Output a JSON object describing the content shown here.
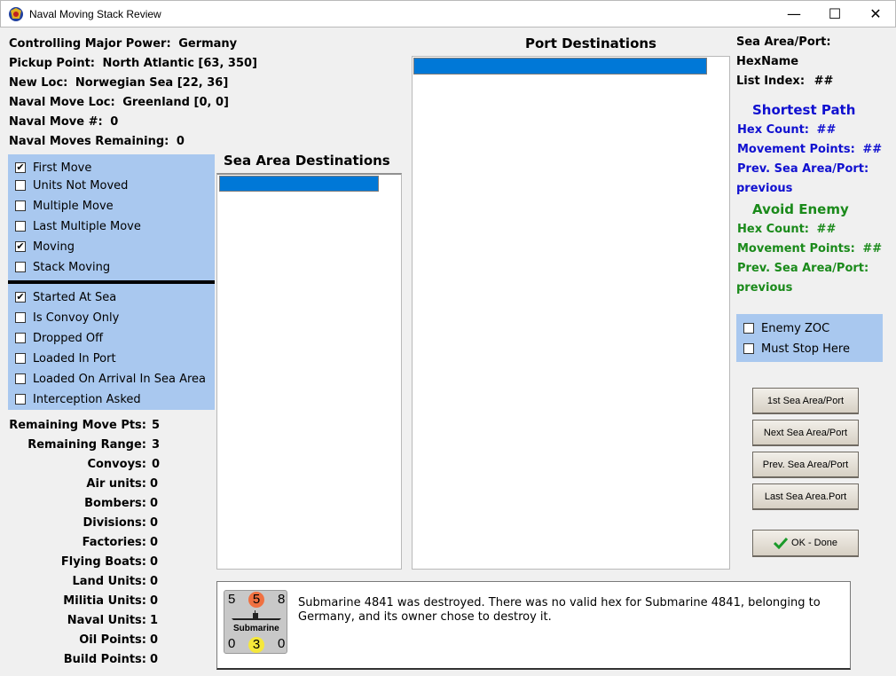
{
  "window": {
    "title": "Naval Moving Stack Review",
    "minimize": "—",
    "maximize": "☐",
    "close": "✕"
  },
  "info": {
    "controlling_label": "Controlling Major Power:",
    "controlling_value": "Germany",
    "pickup_label": "Pickup Point:",
    "pickup_value": "North Atlantic [63, 350]",
    "newloc_label": "New Loc:",
    "newloc_value": "Norwegian Sea [22, 36]",
    "navalmoveloc_label": "Naval Move Loc:",
    "navalmoveloc_value": "Greenland [0, 0]",
    "navalmove_label": "Naval Move #:",
    "navalmove_value": "0",
    "remaining_label": "Naval Moves Remaining:",
    "remaining_value": "0"
  },
  "flags1": [
    {
      "label": "First Move",
      "checked": true
    },
    {
      "label": "Units Not Moved",
      "checked": false
    },
    {
      "label": "Multiple Move",
      "checked": false
    },
    {
      "label": "Last Multiple Move",
      "checked": false
    },
    {
      "label": "Moving",
      "checked": true
    },
    {
      "label": "Stack Moving",
      "checked": false
    }
  ],
  "flags2": [
    {
      "label": "Started At Sea",
      "checked": true
    },
    {
      "label": "Is Convoy Only",
      "checked": false
    },
    {
      "label": "Dropped Off",
      "checked": false
    },
    {
      "label": "Loaded In Port",
      "checked": false
    },
    {
      "label": "Loaded On Arrival In Sea Area",
      "checked": false
    },
    {
      "label": "Interception Asked",
      "checked": false
    }
  ],
  "stats": [
    {
      "label": "Remaining Move Pts:",
      "value": "5"
    },
    {
      "label": "Remaining Range:",
      "value": "3"
    },
    {
      "label": "Convoys:",
      "value": "0"
    },
    {
      "label": "Air units:",
      "value": "0"
    },
    {
      "label": "Bombers:",
      "value": "0"
    },
    {
      "label": "Divisions:",
      "value": "0"
    },
    {
      "label": "Factories:",
      "value": "0"
    },
    {
      "label": "Flying Boats:",
      "value": "0"
    },
    {
      "label": "Land Units:",
      "value": "0"
    },
    {
      "label": "Militia Units:",
      "value": "0"
    },
    {
      "label": "Naval Units:",
      "value": "1"
    },
    {
      "label": "Oil Points:",
      "value": "0"
    },
    {
      "label": "Build Points:",
      "value": "0"
    }
  ],
  "sea_area": {
    "title": "Sea Area Destinations"
  },
  "port": {
    "title": "Port Destinations"
  },
  "right": {
    "sea_area_port": "Sea Area/Port:",
    "hexname": "HexName",
    "list_index_label": "List Index:",
    "list_index_value": "##",
    "shortest": {
      "title": "Shortest Path",
      "hex_count_label": "Hex Count:",
      "hex_count_value": "##",
      "mp_label": "Movement Points:",
      "mp_value": "##",
      "prev_label": "Prev. Sea Area/Port:",
      "prev_value": "previous"
    },
    "avoid": {
      "title": "Avoid Enemy",
      "hex_count_label": "Hex Count:",
      "hex_count_value": "##",
      "mp_label": "Movement Points:",
      "mp_value": "##",
      "prev_label": "Prev. Sea Area/Port:",
      "prev_value": "previous"
    },
    "enemy_zoc": "Enemy ZOC",
    "must_stop": "Must Stop Here"
  },
  "buttons": {
    "first": "1st Sea Area/Port",
    "next": "Next Sea Area/Port",
    "prev": "Prev. Sea Area/Port",
    "last": "Last Sea Area.Port",
    "ok": "OK - Done"
  },
  "counter": {
    "attack": "5",
    "movement_top": "5",
    "defense_top": "8",
    "name": "Submarine",
    "bottom_left": "0",
    "bottom_mid": "3",
    "bottom_right": "0"
  },
  "message": "Submarine 4841 was destroyed.  There was no valid hex for Submarine 4841, belonging to Germany, and its owner chose to destroy it.",
  "colors": {
    "selection": "#0078d7",
    "panel": "#a9c8ef",
    "shortest": "#1010d0",
    "avoid": "#1a8a1a"
  }
}
